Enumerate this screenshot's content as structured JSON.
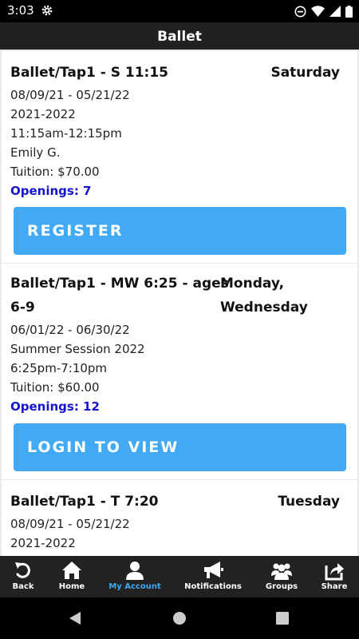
{
  "status_bar": {
    "time": "3:03",
    "icons": [
      "gear-icon",
      "do-not-disturb-icon",
      "wifi-icon",
      "signal-icon",
      "battery-icon"
    ]
  },
  "app_bar": {
    "title": "Ballet"
  },
  "classes": [
    {
      "title": "Ballet/Tap1 - S 11:15",
      "day": "Saturday",
      "lines": [
        "08/09/21 - 05/21/22",
        "2021-2022",
        "11:15am-12:15pm",
        "Emily G.",
        "Tuition: $70.00"
      ],
      "openings": "Openings: 7",
      "button": "REGISTER"
    },
    {
      "title_line1": "Ballet/Tap1 - MW 6:25 - ages",
      "title_line2": "6-9",
      "day_line1": "Monday,",
      "day_line2": "Wednesday",
      "lines": [
        "06/01/22 - 06/30/22",
        "Summer Session 2022",
        "6:25pm-7:10pm",
        "Tuition: $60.00"
      ],
      "openings": "Openings: 12",
      "button": "LOGIN TO VIEW"
    },
    {
      "title": "Ballet/Tap1 - T 7:20",
      "day": "Tuesday",
      "lines": [
        "08/09/21 - 05/21/22",
        "2021-2022"
      ]
    }
  ],
  "bottom_nav": {
    "active": "My Account",
    "items": [
      {
        "label": "Back",
        "icon": "back-icon"
      },
      {
        "label": "Home",
        "icon": "home-icon"
      },
      {
        "label": "My Account",
        "icon": "user-icon"
      },
      {
        "label": "Notifications",
        "icon": "megaphone-icon"
      },
      {
        "label": "Groups",
        "icon": "groups-icon"
      },
      {
        "label": "Share",
        "icon": "share-icon"
      }
    ]
  },
  "colors": {
    "accent": "#42aaf5",
    "openings": "#1515cc",
    "nav_active": "#3fa9f5",
    "bar_bg": "#212121"
  }
}
